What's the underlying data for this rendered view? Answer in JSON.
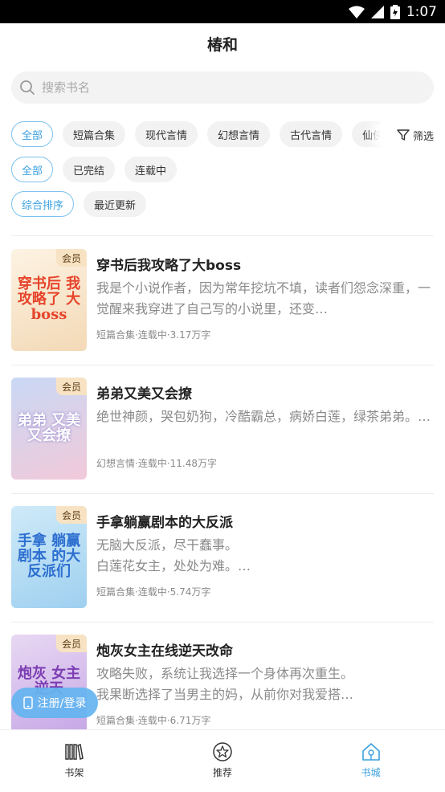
{
  "status_bar": {
    "time": "1:07"
  },
  "header": {
    "title": "椿和"
  },
  "search": {
    "placeholder": "搜索书名"
  },
  "category_chips": [
    "全部",
    "短篇合集",
    "现代言情",
    "幻想言情",
    "古代言情",
    "仙侠奇"
  ],
  "status_chips": [
    "全部",
    "已完结",
    "连载中"
  ],
  "sort_chips": [
    "综合排序",
    "最近更新"
  ],
  "filter_label": "筛选",
  "books": [
    {
      "title": "穿书后我攻略了大boss",
      "desc": "我是个小说作者，因为常年挖坑不填，读者们怨念深重，一觉醒来我穿进了自己写的小说里，还变…",
      "meta": "短篇合集·连载中·3.17万字",
      "badge": "会员",
      "cover_text": "穿书后 我攻略了 大boss",
      "cover_colors": [
        "#fdf3e3",
        "#f3d9b6"
      ],
      "cover_text_color": "#e6442b"
    },
    {
      "title": "弟弟又美又会撩",
      "desc": "绝世神颜，哭包奶狗，冷酷霸总，病娇白莲，绿茶弟弟。…",
      "meta": "幻想言情·连载中·11.48万字",
      "badge": "会员",
      "cover_text": "弟弟 又美 又会撩",
      "cover_colors": [
        "#c9d8f5",
        "#f1c9d9"
      ],
      "cover_text_color": "#ffffff"
    },
    {
      "title": "手拿躺赢剧本的大反派",
      "desc": "无脑大反派，尽干蠢事。\n白莲花女主，处处为难。…",
      "meta": "短篇合集·连载中·5.74万字",
      "badge": "会员",
      "cover_text": "手拿 躺赢剧本 的大反派们",
      "cover_colors": [
        "#cfeaf8",
        "#9fd0f0"
      ],
      "cover_text_color": "#2d6fd0"
    },
    {
      "title": "炮灰女主在线逆天改命",
      "desc": "攻略失败，系统让我选择一个身体再次重生。\n我果断选择了当男主的妈，从前你对我爱搭…",
      "meta": "短篇合集·连载中·6.71万字",
      "badge": "会员",
      "cover_text": "炮灰 女主 逆天",
      "cover_colors": [
        "#e8d8f3",
        "#c7a9e6"
      ],
      "cover_text_color": "#7c3db3"
    }
  ],
  "login_button": "注册/登录",
  "tabs": [
    {
      "label": "书架",
      "icon": "bookshelf-icon"
    },
    {
      "label": "推荐",
      "icon": "star-icon"
    },
    {
      "label": "书城",
      "icon": "home-icon"
    }
  ],
  "colors": {
    "accent": "#3aa0e0",
    "vip_bg": "#f7e3c4"
  }
}
